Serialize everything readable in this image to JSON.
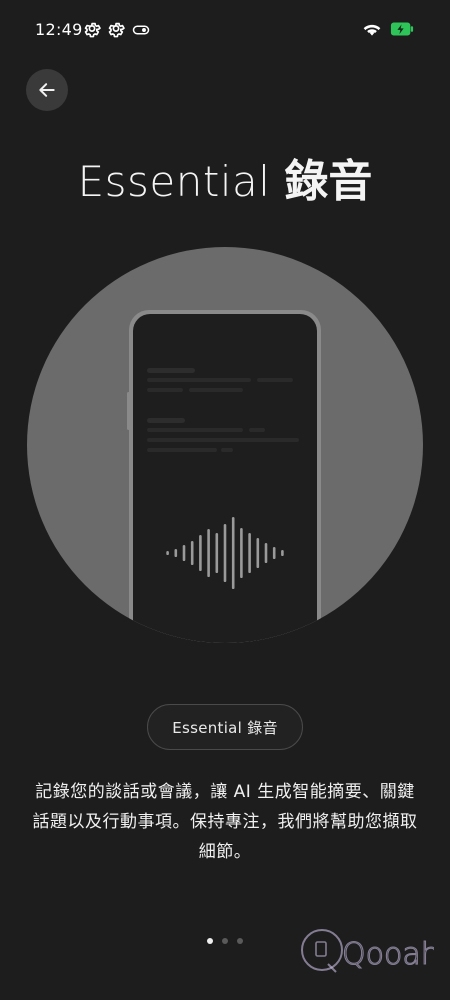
{
  "status_bar": {
    "time": "12:49",
    "icons": [
      "gear-icon",
      "gear-icon",
      "toggle-icon",
      "wifi-icon",
      "battery-charging-icon"
    ],
    "battery_color": "#2ec45a"
  },
  "header": {
    "back_icon": "arrow-left-icon",
    "title_light": "Essential",
    "title_bold": "錄音"
  },
  "pill": {
    "label": "Essential 錄音"
  },
  "description": "記錄您的談話或會議，讓 AI 生成智能摘要、關鍵話題以及行動事項。保持專注，我們將幫助您擷取細節。",
  "pagination": {
    "total": 3,
    "active_index": 0
  },
  "watermark": {
    "text": "Qooah"
  },
  "colors": {
    "background": "#1d1d1d",
    "circle": "#6a6a6a",
    "phone_screen": "#1e1e1e"
  }
}
